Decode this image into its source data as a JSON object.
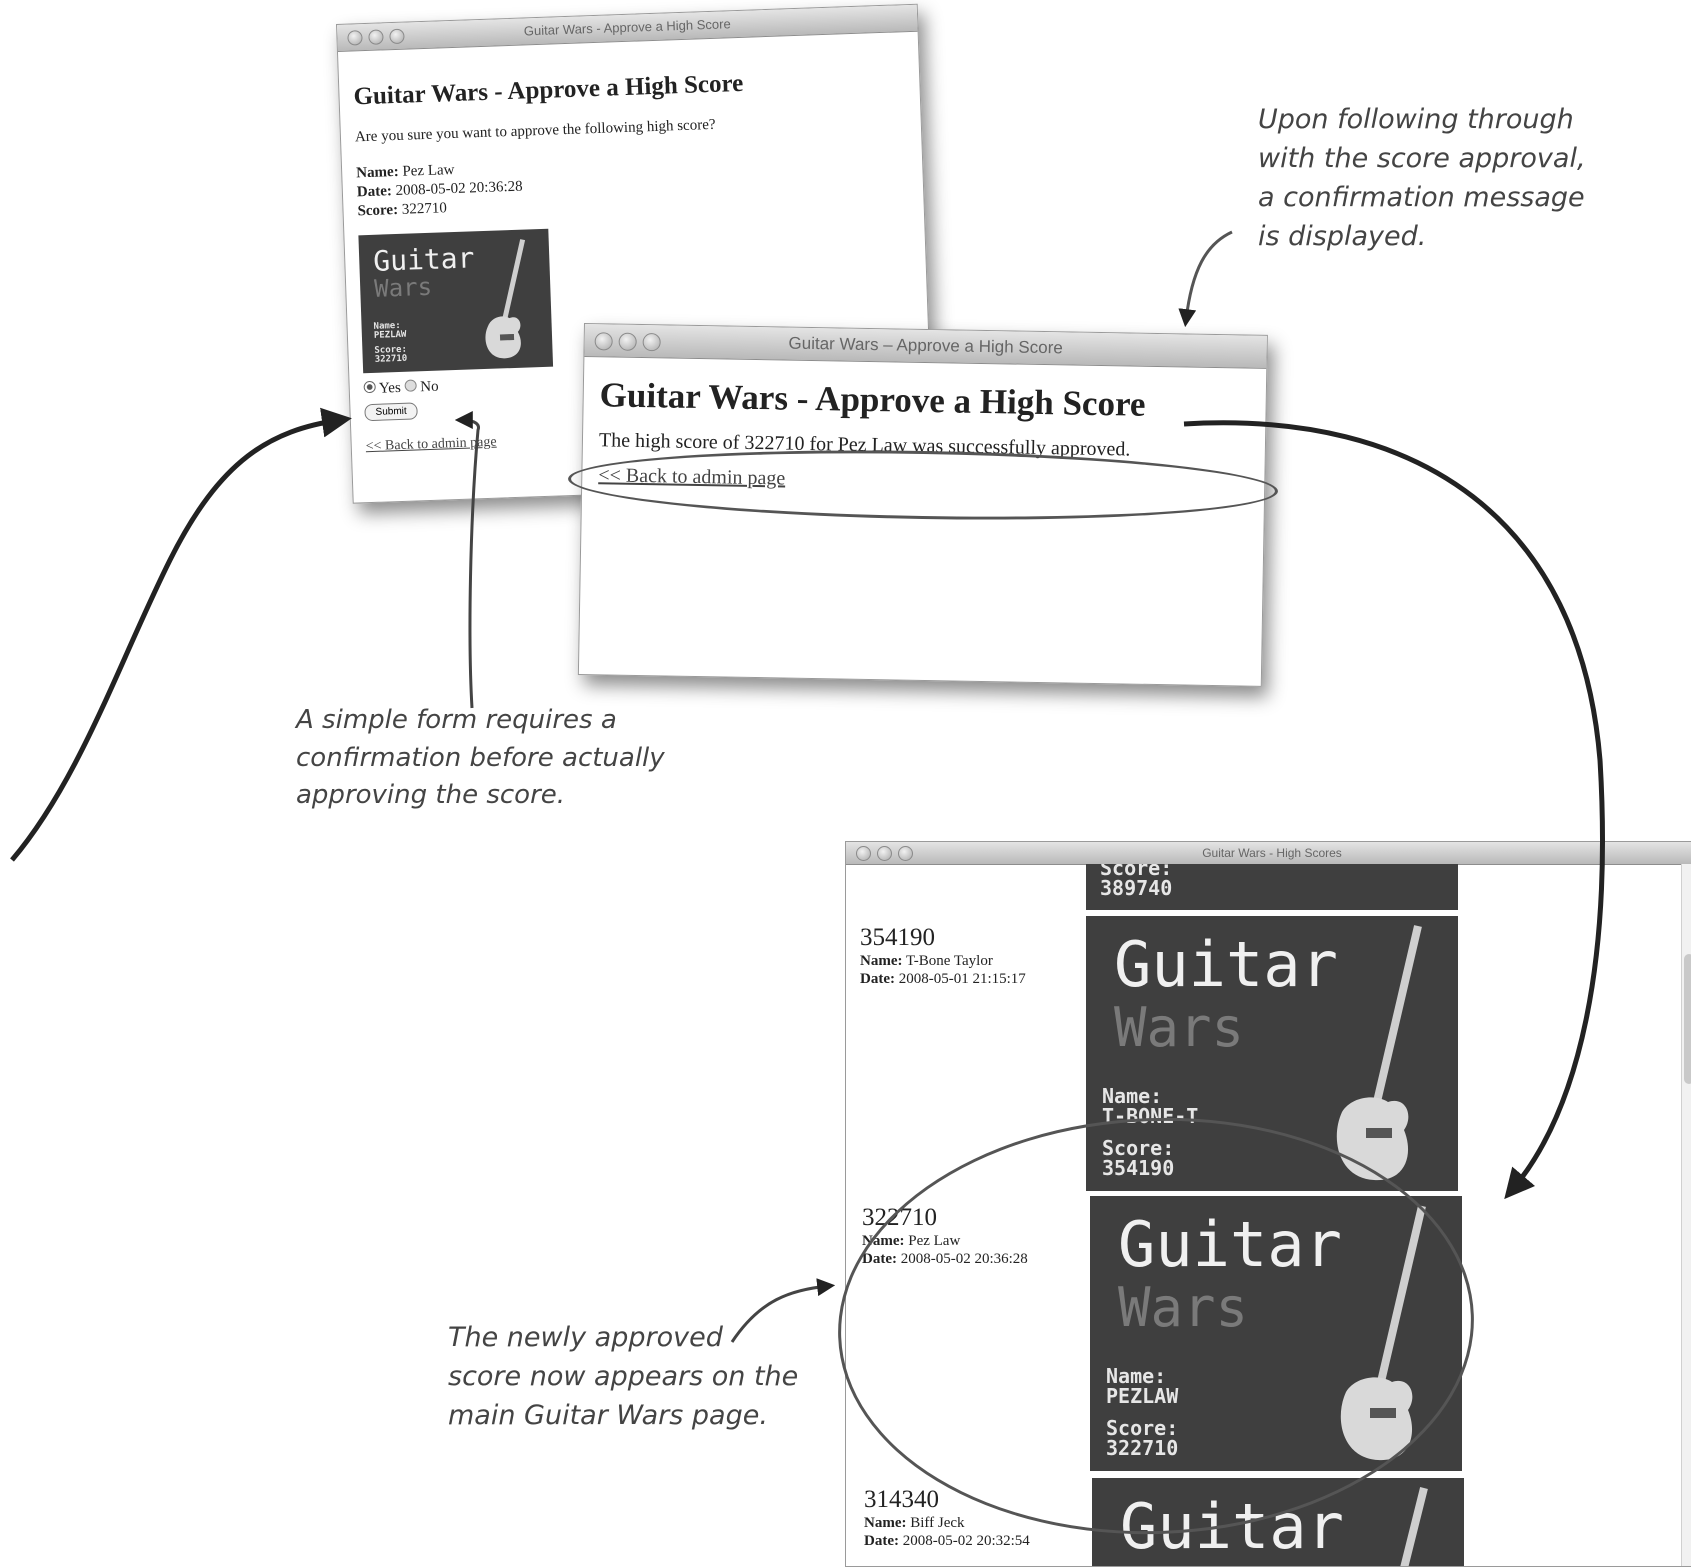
{
  "window_confirm": {
    "title_bar": "Guitar Wars - Approve a High Score",
    "heading": "Guitar Wars - Approve a High Score",
    "prompt": "Are you sure you want to approve the following high score?",
    "name_label": "Name:",
    "name_value": "Pez Law",
    "date_label": "Date:",
    "date_value": "2008-05-02 20:36:28",
    "score_label": "Score:",
    "score_value": "322710",
    "image": {
      "title": "Guitar",
      "subtitle": "Wars",
      "name_text": "Name:\nPEZLAW",
      "score_text": "Score:\n322710"
    },
    "radio_yes": "Yes",
    "radio_no": "No",
    "radio_selected": "Yes",
    "submit_label": "Submit",
    "back_link": "<< Back to admin page"
  },
  "window_success": {
    "title_bar": "Guitar Wars – Approve a High Score",
    "heading": "Guitar Wars - Approve a High Score",
    "message": "The high score of 322710 for Pez Law was successfully approved.",
    "back_link": "<< Back to admin page"
  },
  "window_scores": {
    "title_bar": "Guitar Wars - High Scores",
    "top_partial": {
      "score_text": "Score:\n389740"
    },
    "rows": [
      {
        "score": "354190",
        "name_label": "Name:",
        "name": "T-Bone Taylor",
        "date_label": "Date:",
        "date": "2008-05-01 21:15:17",
        "image": {
          "title": "Guitar",
          "subtitle": "Wars",
          "name_text": "Name:\nT-BONE-T",
          "score_text": "Score:\n354190"
        }
      },
      {
        "score": "322710",
        "name_label": "Name:",
        "name": "Pez Law",
        "date_label": "Date:",
        "date": "2008-05-02 20:36:28",
        "image": {
          "title": "Guitar",
          "subtitle": "Wars",
          "name_text": "Name:\nPEZLAW",
          "score_text": "Score:\n322710"
        }
      },
      {
        "score": "314340",
        "name_label": "Name:",
        "name": "Biff Jeck",
        "date_label": "Date:",
        "date": "2008-05-02 20:32:54",
        "image": {
          "title": "Guitar"
        }
      }
    ]
  },
  "annotations": {
    "upper_right": "Upon following through\nwith the score approval,\na confirmation message\nis displayed.",
    "middle_left": "A simple form requires a\nconfirmation before actually\napproving the score.",
    "lower_left": "The newly approved\nscore now appears on the\nmain Guitar Wars page."
  },
  "icons": [
    "traffic-lights-icon",
    "guitar-icon",
    "radio-icon",
    "arrow-icon"
  ],
  "colors": {
    "image_bg": "#3f3f3f",
    "annotation": "#444444",
    "titlebar": "#c8c8c8"
  }
}
